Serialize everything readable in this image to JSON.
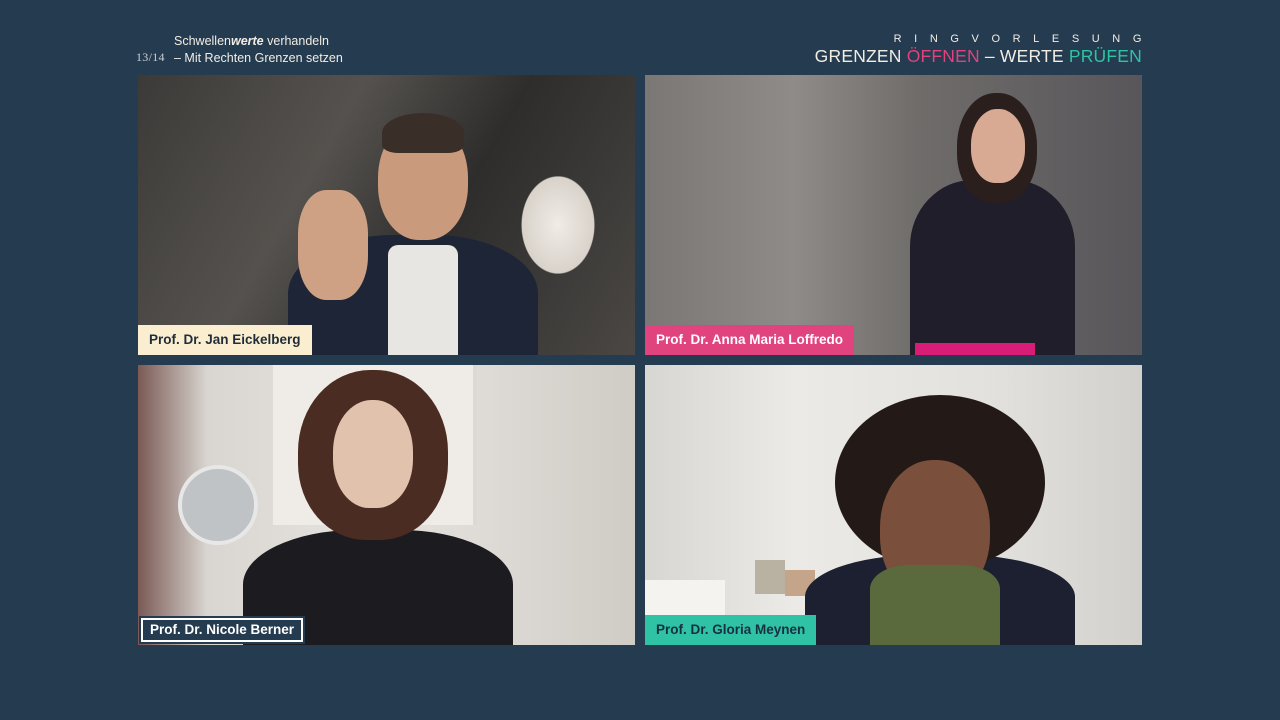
{
  "header": {
    "counter": "13/14",
    "subtitle_line1_prefix": "Schwellen",
    "subtitle_line1_emph": "werte",
    "subtitle_line1_suffix": " verhandeln",
    "subtitle_line2": "– Mit Rechten Grenzen setzen",
    "series_label": "RINGVORLESUNG",
    "series_title_part1": "GRENZEN ",
    "series_title_part2": "ÖFFNEN",
    "series_title_part3": " – WERTE ",
    "series_title_part4": "PRÜFEN"
  },
  "participants": [
    {
      "name": "Prof. Dr. Jan Eickelberg",
      "tag_color": "#fbeed0"
    },
    {
      "name": "Prof. Dr. Anna Maria Loffredo",
      "tag_color": "#e0437e"
    },
    {
      "name": "Prof. Dr. Nicole Berner",
      "tag_color": "#243b50"
    },
    {
      "name": "Prof. Dr. Gloria Meynen",
      "tag_color": "#2fc2a4"
    }
  ],
  "colors": {
    "background": "#243b50",
    "accent_pink": "#e0437e",
    "accent_teal": "#2fc2a4",
    "cream": "#fbeed0"
  }
}
